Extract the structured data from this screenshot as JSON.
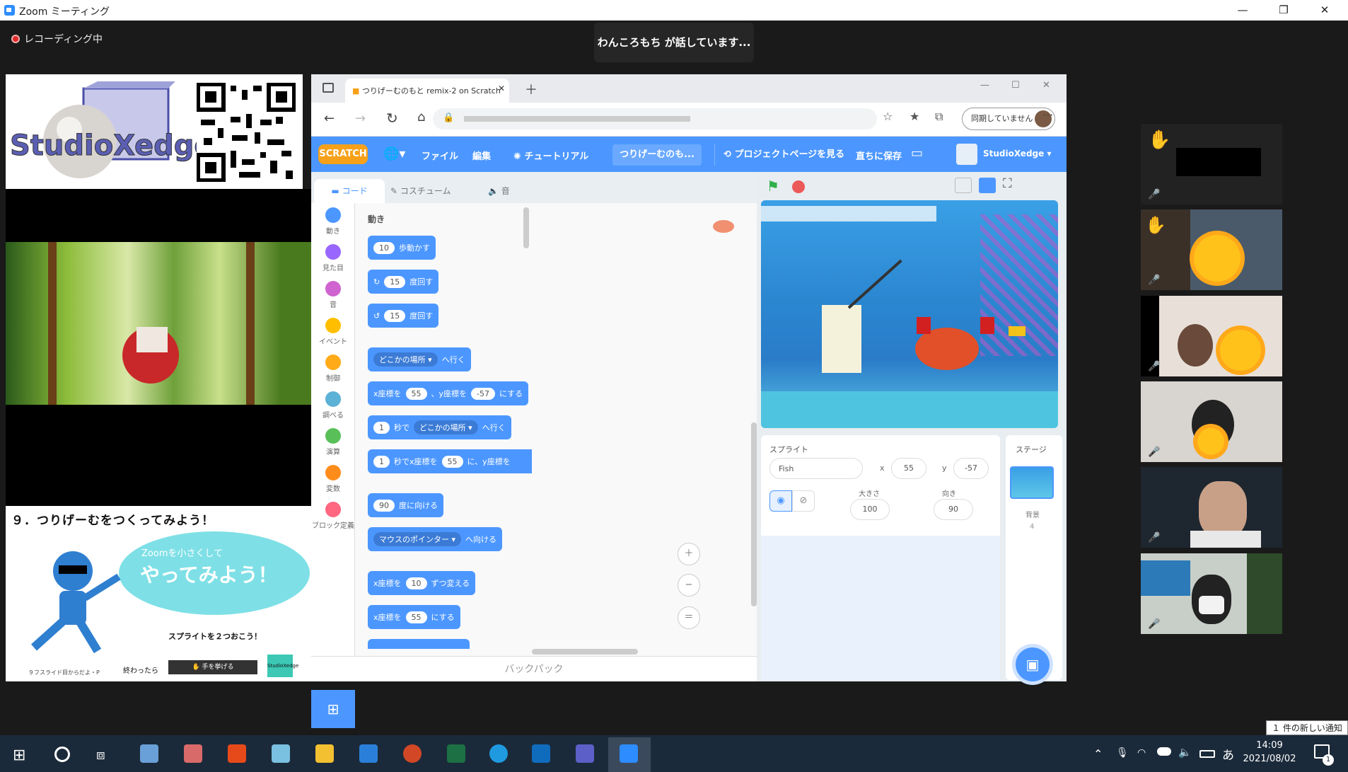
{
  "window": {
    "title": "Zoom ミーティング",
    "minimize": "—",
    "restore": "❐",
    "close": "✕"
  },
  "meeting": {
    "recording": "レコーディング中",
    "speaker": "わんころもち が話しています..."
  },
  "left_panel": {
    "logo_text": "StudioXedge",
    "slide_title": "９．つりげーむをつくってみよう！",
    "bubble_small": "Zoomを小さくして",
    "bubble_big": "やってみよう！",
    "instruction": "スプライトを２つおこう！",
    "done_label": "終わったら",
    "raise_hand": "手を挙げる",
    "slide_footer": "９フスライド目からだよ・P",
    "slide_logo": "StudioXedge"
  },
  "browser": {
    "tab_title": "つりげーむのもと remix-2 on Scratch",
    "sync_label": "同期していません",
    "more": "···"
  },
  "scratch": {
    "logo": "SCRATCH",
    "menu": [
      "ファイル",
      "編集",
      "チュートリアル",
      "つりげーむのも...",
      "プロジェクトページを見る",
      "直ちに保存"
    ],
    "user": "StudioXedge",
    "tabs": [
      "コード",
      "コスチューム",
      "音"
    ],
    "categories": [
      {
        "label": "動き",
        "color": "#4c97ff"
      },
      {
        "label": "見た目",
        "color": "#9966ff"
      },
      {
        "label": "音",
        "color": "#cf63cf"
      },
      {
        "label": "イベント",
        "color": "#ffbf00"
      },
      {
        "label": "制御",
        "color": "#ffab19"
      },
      {
        "label": "調べる",
        "color": "#5cb1d6"
      },
      {
        "label": "演算",
        "color": "#59c059"
      },
      {
        "label": "変数",
        "color": "#ff8c1a"
      },
      {
        "label": "ブロック定義",
        "color": "#ff6680"
      }
    ],
    "palette_heading": "動き",
    "blocks": {
      "move_val": "10",
      "move_text": "歩動かす",
      "turn_r_val": "15",
      "turn_r_text": "度回す",
      "turn_l_val": "15",
      "turn_l_text": "度回す",
      "goto_dd": "どこかの場所",
      "goto_text": "へ行く",
      "setxy_a": "x座標を",
      "setxy_x": "55",
      "setxy_b": "、y座標を",
      "setxy_y": "-57",
      "setxy_c": "にする",
      "glide_val": "1",
      "glide_a": "秒で",
      "glide_dd": "どこかの場所",
      "glide_b": "へ行く",
      "glidexy_val": "1",
      "glidexy_a": "秒でx座標を",
      "glidexy_x": "55",
      "glidexy_b": "に、y座標を",
      "point_val": "90",
      "point_text": "度に向ける",
      "pointto_dd": "マウスのポインター",
      "pointto_text": "へ向ける",
      "changex_a": "x座標を",
      "changex_val": "10",
      "changex_b": "ずつ変える",
      "setx_a": "x座標を",
      "setx_val": "55",
      "setx_b": "にする"
    },
    "backpack": "バックパック",
    "sprite": {
      "label": "スプライト",
      "name": "Fish",
      "x_label": "x",
      "x": "55",
      "y_label": "y",
      "y": "-57",
      "size_label": "大きさ",
      "size": "100",
      "dir_label": "向き",
      "dir": "90"
    },
    "stage": {
      "label": "ステージ",
      "backdrops_label": "背景",
      "backdrops": "4"
    }
  },
  "participants_hand": "✋",
  "notification": "１ 件の新しい通知",
  "taskbar": {
    "ime": "あ",
    "time": "14:09",
    "date": "2021/08/02",
    "notif_count": "1"
  },
  "colors": {
    "zoom_blue": "#2d8cff",
    "scratch_blue": "#4c97ff",
    "sun": "#ffc21a"
  }
}
